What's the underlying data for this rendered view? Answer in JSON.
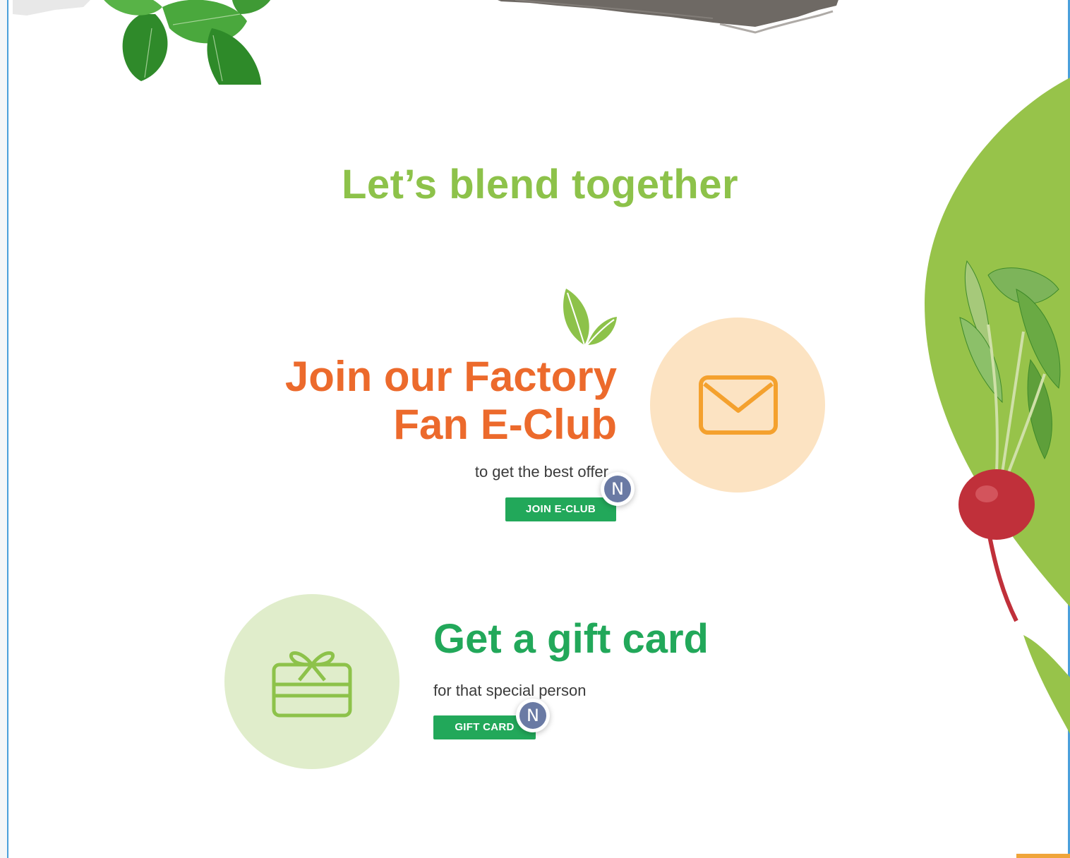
{
  "headline": "Let’s blend together",
  "eclub": {
    "title_line1": "Join our Factory",
    "title_line2": "Fan E-Club",
    "subtitle": "to get the best offer",
    "button_label": "JOIN E-CLUB",
    "icon": "envelope-icon"
  },
  "gift": {
    "title": "Get a gift card",
    "subtitle": "for that special person",
    "button_label": "GIFT CARD",
    "icon": "gift-card-icon"
  },
  "overlay_badges": [
    {
      "letter": "N"
    },
    {
      "letter": "N"
    }
  ],
  "colors": {
    "headline_green": "#8dc24a",
    "eclub_orange": "#ec6a2c",
    "gift_green": "#22a85a",
    "button_green": "#22a85a",
    "mail_circle": "#fce3c2",
    "mail_icon": "#f4a12e",
    "gift_circle": "#e0edcb",
    "gift_icon": "#8dc24a",
    "badge": "#6a7aa4"
  },
  "decorations": [
    "mint-leaves-image",
    "brush-stroke",
    "green-blob",
    "radish-image",
    "leaf-icon"
  ]
}
